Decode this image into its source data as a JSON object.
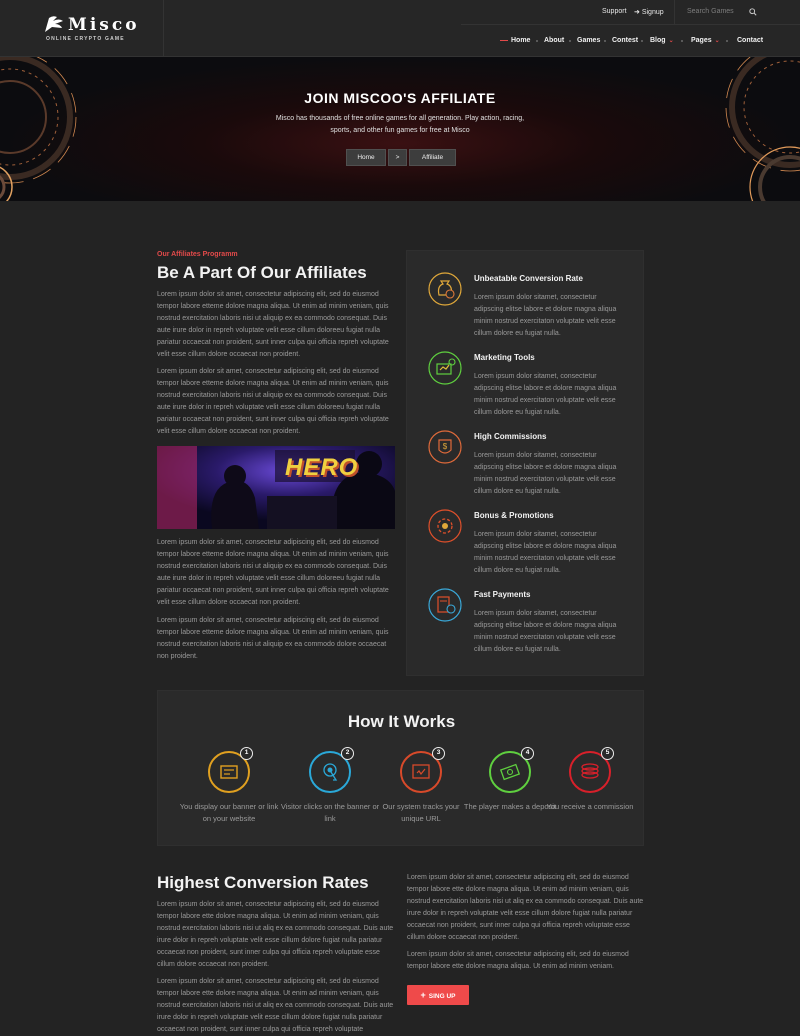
{
  "header": {
    "logo_name": "Misco",
    "logo_tagline": "ONLINE CRYPTO GAME",
    "support": "Support",
    "signup": "Signup",
    "search_placeholder": "Search Games",
    "nav": [
      {
        "label": "Home",
        "active": true
      },
      {
        "label": "About"
      },
      {
        "label": "Games"
      },
      {
        "label": "Contest"
      },
      {
        "label": "Blog",
        "dropdown": true
      },
      {
        "label": "Pages",
        "dropdown": true
      },
      {
        "label": "Contact"
      }
    ]
  },
  "hero": {
    "title": "JOIN MISCOO'S AFFILIATE",
    "subtitle": "Misco has thousands of free online games for all generation. Play action, racing, sports, and other fun games for free at Misco",
    "breadcrumb": [
      "Home",
      ">",
      "Affiliate"
    ]
  },
  "affiliates": {
    "eyebrow": "Our Affiliates Programm",
    "heading": "Be A Part Of Our Affiliates",
    "paragraphs": [
      "Lorem ipsum dolor sit amet, consectetur adipiscing elit, sed do eiusmod tempor labore etteme dolore magna aliqua. Ut enim ad minim veniam, quis nostrud exercitation laboris nisi ut aliquip ex ea commodo consequat. Duis aute irure dolor in repreh voluptate velit esse cillum doloreeu fugiat nulla pariatur occaecat non proident, sunt inner culpa qui officia repreh voluptate velit esse cillum dolore occaecat non proident.",
      "Lorem ipsum dolor sit amet, consectetur adipiscing elit, sed do eiusmod tempor labore etteme dolore magna aliqua. Ut enim ad minim veniam, quis nostrud exercitation laboris nisi ut aliquip ex ea commodo consequat. Duis aute irure dolor in repreh voluptate velit esse cillum doloreeu fugiat nulla pariatur occaecat non proident, sunt inner culpa qui officia repreh voluptate velit esse cillum dolore occaecat non proident.",
      "Lorem ipsum dolor sit amet, consectetur adipiscing elit, sed do eiusmod tempor labore etteme dolore magna aliqua. Ut enim ad minim veniam, quis nostrud exercitation laboris nisi ut aliquip ex ea commodo consequat. Duis aute irure dolor in repreh voluptate velit esse cillum doloreeu fugiat nulla pariatur occaecat non proident, sunt inner culpa qui officia repreh voluptate velit esse cillum dolore occaecat non proident.",
      "Lorem ipsum dolor sit amet, consectetur adipiscing elit, sed do eiusmod tempor labore etteme dolore magna aliqua. Ut enim ad minim veniam, quis nostrud exercitation laboris nisi ut aliquip ex ea commodo dolore occaecat non proident."
    ],
    "photo_sign_text": "HERO"
  },
  "features": [
    {
      "title": "Unbeatable Conversion Rate",
      "icon": "coin-bag-icon",
      "color": "#e0a83a",
      "text": "Lorem ipsum dolor sitamet, consectetur adipscing elitse labore et dolore magna aliqua minim nostrud exercitaton voluptate velit esse cillum dolore eu fugiat nulla."
    },
    {
      "title": "Marketing Tools",
      "icon": "tools-icon",
      "color": "#5fcf3f",
      "text": "Lorem ipsum dolor sitamet, consectetur adipscing elitse labore et dolore magna aliqua minim nostrud exercitaton voluptate velit esse cillum dolore eu fugiat nulla."
    },
    {
      "title": "High Commissions",
      "icon": "commission-badge-icon",
      "color": "#e06a3a",
      "text": "Lorem ipsum dolor sitamet, consectetur adipscing elitse labore et dolore magna aliqua minim nostrud exercitaton voluptate velit esse cillum dolore eu fugiat nulla."
    },
    {
      "title": "Bonus & Promotions",
      "icon": "bonus-gear-icon",
      "color": "#e0502a",
      "text": "Lorem ipsum dolor sitamet, consectetur adipscing elitse labore et dolore magna aliqua minim nostrud exercitaton voluptate velit esse cillum dolore eu fugiat nulla."
    },
    {
      "title": "Fast Payments",
      "icon": "payment-calculator-icon",
      "color": "#3aa8d8",
      "text": "Lorem ipsum dolor sitamet, consectetur adipscing elitse labore et dolore magna aliqua minim nostrud exercitaton voluptate velit esse cillum dolore eu fugiat nulla."
    }
  ],
  "how_it_works": {
    "title": "How It Works",
    "steps": [
      {
        "num": "1",
        "label": "You display our banner or link on your website",
        "color": "#e0a020",
        "icon": "banner-icon"
      },
      {
        "num": "2",
        "label": "Visitor clicks on the banner or link",
        "color": "#2aa8d8",
        "icon": "click-icon"
      },
      {
        "num": "3",
        "label": "Our system tracks your unique URL",
        "color": "#d84a2a",
        "icon": "tracking-icon"
      },
      {
        "num": "4",
        "label": "The player makes a deposit",
        "color": "#5fcf3f",
        "icon": "deposit-icon"
      },
      {
        "num": "5",
        "label": "You receive a commission",
        "color": "#d8202a",
        "icon": "coins-icon"
      }
    ]
  },
  "conversion": {
    "heading": "Highest Conversion Rates",
    "left_paragraphs": [
      "Lorem ipsum dolor sit amet, consectetur adipiscing elit, sed do eiusmod tempor labore ette dolore magna aliqua. Ut enim ad minim veniam, quis nostrud exercitation laboris nisi ut aliq ex ea commodo consequat. Duis aute irure dolor in repreh voluptate velit esse cillum dolore fugiat nulla pariatur occaecat non proident, sunt inner culpa qui officia repreh voluptate esse cillum dolore occaecat non proident.",
      "Lorem ipsum dolor sit amet, consectetur adipiscing elit, sed do eiusmod tempor labore ette dolore magna aliqua. Ut enim ad minim veniam, quis nostrud exercitation laboris nisi ut aliq ex ea commodo consequat. Duis aute irure dolor in repreh voluptate velit esse cillum dolore fugiat nulla pariatur occaecat non proident, sunt inner culpa qui officia repreh voluptate"
    ],
    "right_paragraphs": [
      "Lorem ipsum dolor sit amet, consectetur adipiscing elit, sed do eiusmod tempor labore ette dolore magna aliqua. Ut enim ad minim veniam, quis nostrud exercitation laboris nisi ut aliq ex ea commodo consequat. Duis aute irure dolor in repreh voluptate velit esse cillum dolore fugiat nulla pariatur occaecat non proident, sunt inner culpa qui officia repreh voluptate esse cillum dolore occaecat non proident.",
      "Lorem ipsum dolor sit amet, consectetur adipiscing elit, sed do eiusmod tempor labore ette dolore magna aliqua. Ut enim ad minim veniam."
    ],
    "button_label": "SING UP"
  },
  "colors": {
    "accent": "#e24a4a",
    "background": "#232323",
    "panel": "#2a2a2a"
  }
}
